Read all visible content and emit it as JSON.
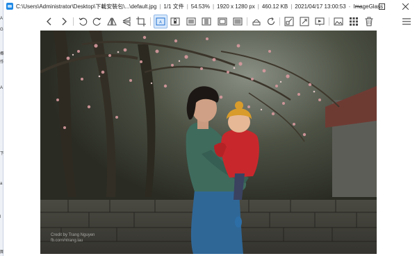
{
  "window": {
    "path": "C:\\Users\\Administrator\\Desktop\\下載安裝包\\...\\default.jpg",
    "file_index": "1/1 文件",
    "zoom": "54.53%",
    "dimensions": "1920 x 1280 px",
    "file_size": "460.12 KB",
    "datetime": "2021/04/17 13:00:53",
    "app_name": "ImageGlass"
  },
  "toolbar": {
    "buttons": [
      "prev-image",
      "next-image",
      "rotate-left",
      "rotate-right",
      "flip-horizontal",
      "flip-vertical",
      "crop",
      "auto-zoom",
      "lock-zoom",
      "scale-to-width",
      "scale-to-height",
      "scale-to-fit",
      "scale-to-fill",
      "color-picker",
      "refresh",
      "open-location",
      "fullscreen",
      "slideshow",
      "set-wallpaper",
      "thumbnails",
      "delete",
      "menu"
    ],
    "active": "auto-zoom",
    "icon_color": "#4a4a4a",
    "active_color": "#1e6fd0"
  },
  "photo": {
    "credit_line1": "Credit by Trang Nguyen",
    "credit_line2": "fb.com/ntrang.lau"
  },
  "desktop_strip": {
    "chars": [
      "A",
      "G",
      "概",
      "作",
      "A",
      "下",
      "a",
      "l",
      "图"
    ]
  }
}
